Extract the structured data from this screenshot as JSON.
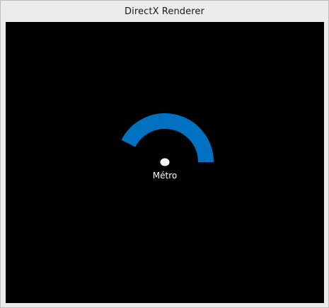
{
  "window": {
    "title": "DirectX Renderer"
  },
  "scene": {
    "marker_label": "Métro",
    "marker_color": "#ffffff",
    "arc_color": "#0070c0",
    "background_color": "#000000"
  }
}
